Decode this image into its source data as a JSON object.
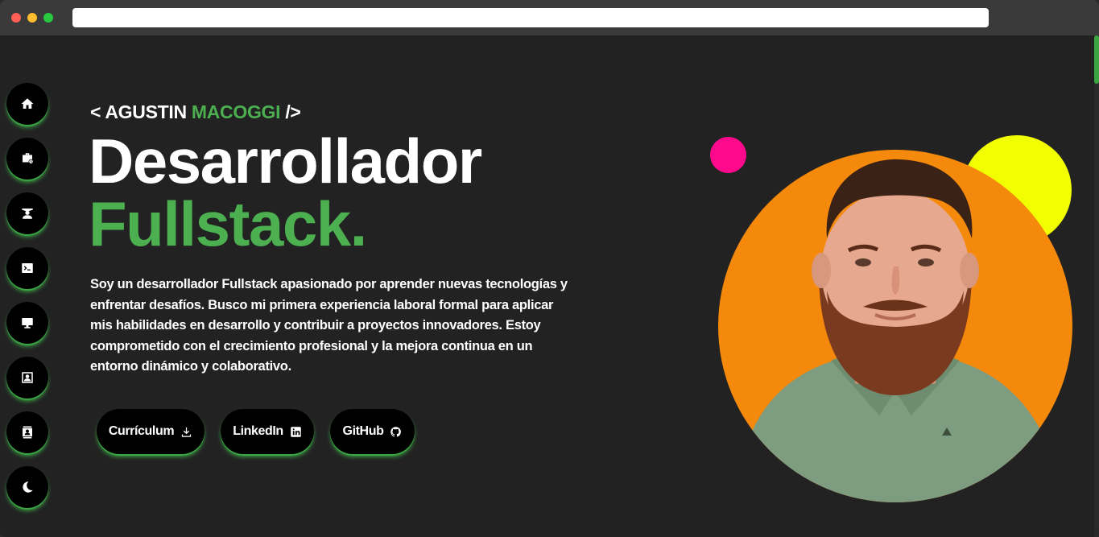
{
  "header": {
    "tag_prefix": "< AGUSTIN",
    "tag_highlight": "MACOGGI",
    "tag_suffix": "/>",
    "title_line1": "Desarrollador",
    "title_line2": "Fullstack."
  },
  "description": "Soy un desarrollador Fullstack apasionado por aprender nuevas tecnologías y enfrentar desafíos. Busco mi primera experiencia laboral formal para aplicar mis habilidades en desarrollo y contribuir a proyectos innovadores. Estoy comprometido con el crecimiento profesional y la mejora continua en un entorno dinámico y colaborativo.",
  "buttons": {
    "curriculum": "Currículum",
    "linkedin": "LinkedIn",
    "github": "GitHub"
  },
  "sidenav": {
    "items": [
      "home-icon",
      "briefcase-icon",
      "graduate-icon",
      "terminal-icon",
      "monitor-icon",
      "profile-icon",
      "contact-card-icon",
      "moon-icon"
    ]
  },
  "colors": {
    "accent": "#4caf50",
    "background": "#222222",
    "photo_bg": "#f5890c",
    "pink": "#ff0a8c",
    "yellow": "#f2ff00"
  }
}
